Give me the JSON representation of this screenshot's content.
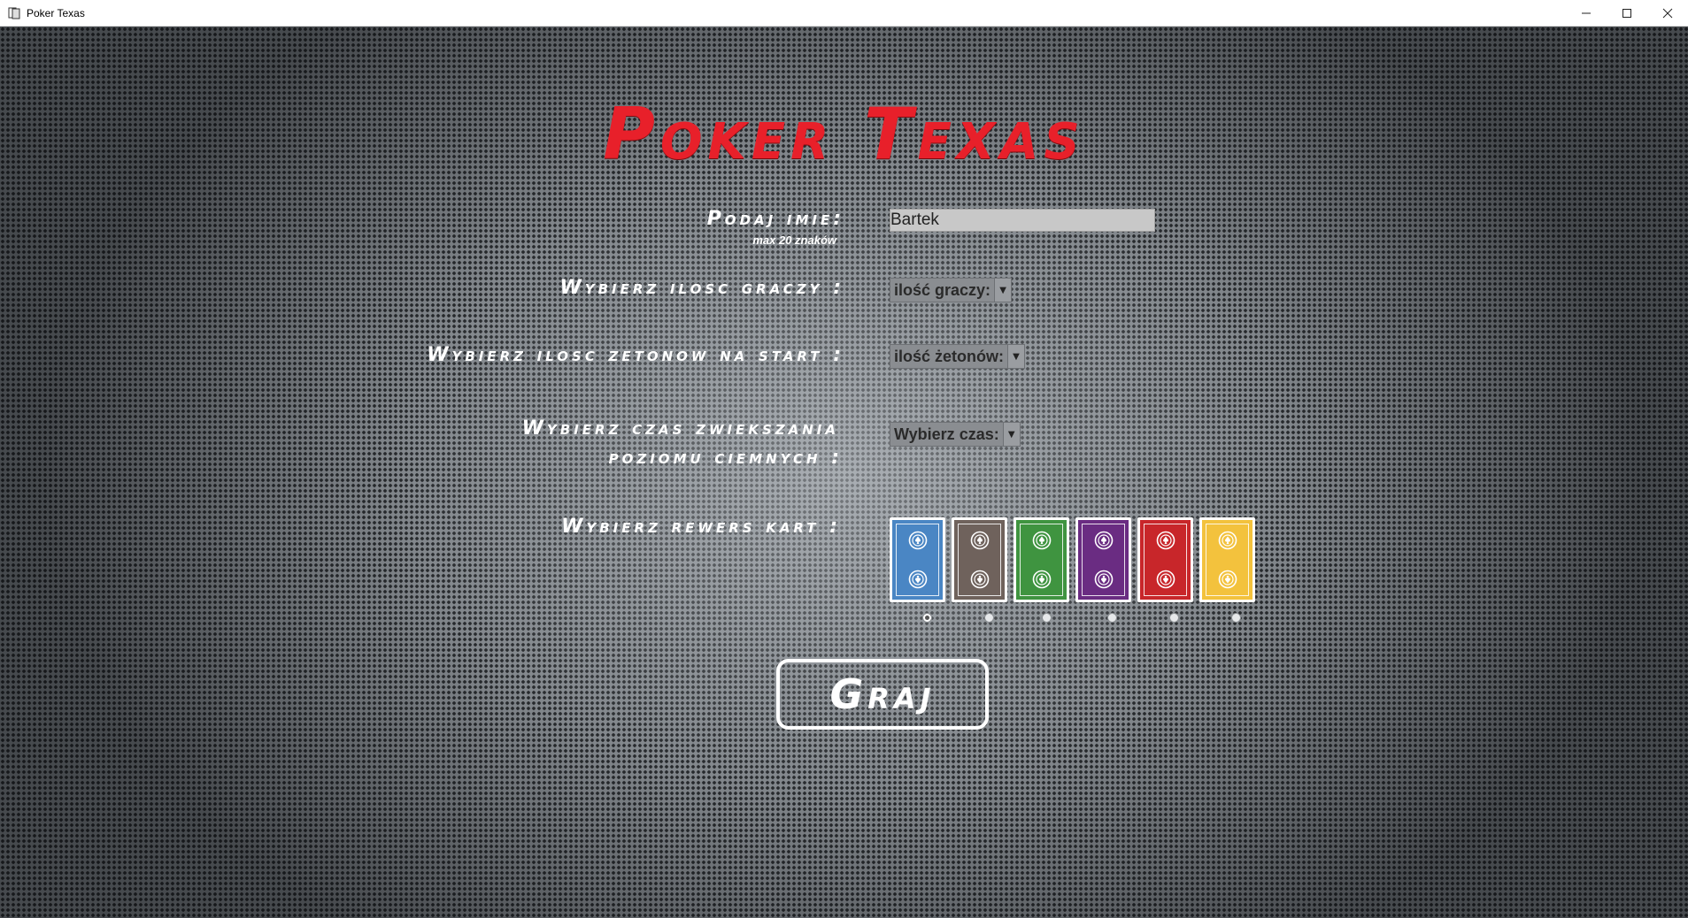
{
  "window": {
    "title": "Poker Texas",
    "icon": "card-app-icon",
    "controls": {
      "minimize": "—",
      "maximize": "☐",
      "close": "✕"
    }
  },
  "main": {
    "heading": "Poker Texas",
    "name": {
      "label": "Podaj imie:",
      "hint": "max 20 znaków",
      "value": "Bartek"
    },
    "players": {
      "label": "Wybierz ilosc graczy :",
      "selected": "ilość graczy:"
    },
    "chips": {
      "label": "Wybierz ilosc zetonow na start :",
      "selected": "ilość żetonów:"
    },
    "blinds": {
      "label_line1": "Wybierz czas zwiekszania",
      "label_line2": "poziomu ciemnych :",
      "selected": "Wybierz czas:"
    },
    "card_back": {
      "label": "Wybierz rewers kart :",
      "options": [
        {
          "name": "blue",
          "color": "#4a86c4"
        },
        {
          "name": "brown",
          "color": "#6f625c"
        },
        {
          "name": "green",
          "color": "#3f9440"
        },
        {
          "name": "purple",
          "color": "#6a2c82"
        },
        {
          "name": "red",
          "color": "#c8262a"
        },
        {
          "name": "yellow",
          "color": "#f3c23d"
        }
      ],
      "selected_index": 0
    },
    "play_button": "Graj"
  }
}
